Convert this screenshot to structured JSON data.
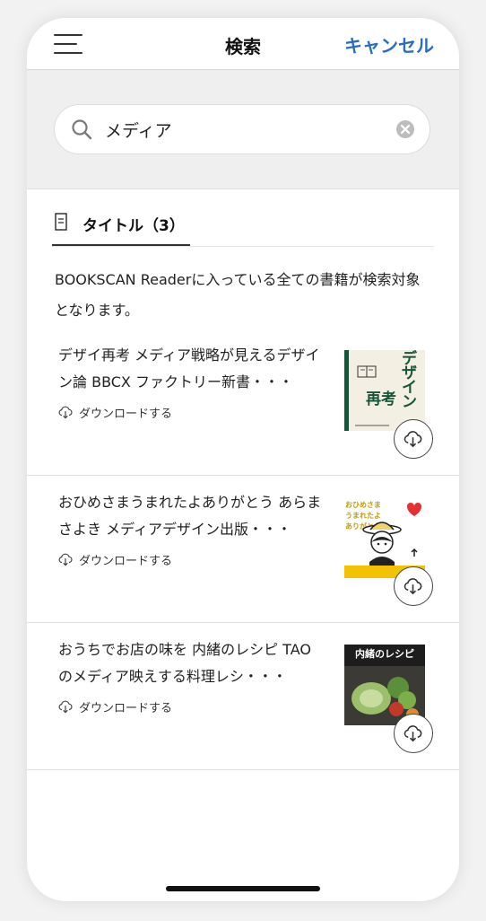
{
  "nav": {
    "title": "検索",
    "cancel_label": "キャンセル",
    "menu_icon": "hamburger-menu-icon"
  },
  "search": {
    "value": "メディア",
    "placeholder": ""
  },
  "tabs": [
    {
      "label": "タイトル（3）",
      "icon": "document-icon",
      "active": true
    }
  ],
  "description": "BOOKSCAN Readerに入っている全ての書籍が検索対象となります。",
  "books": [
    {
      "title": "デザイ再考 メディア戦略が見えるデザイン論 BBCX ファクトリー新書・・・",
      "download_label": "ダウンロードする",
      "cover": {
        "text_main": "デザイン",
        "text_sub": "再考",
        "bg": "#f3efe2",
        "accent": "#17553a"
      }
    },
    {
      "title": "おひめさまうまれたよありがとう あらまさよき メディアデザイン出版・・・",
      "download_label": "ダウンロードする",
      "cover": {
        "text_main": "おひめさま うまれたよ ありがとう",
        "bg": "#ffffff",
        "accent": "#f2c200"
      }
    },
    {
      "title": "おうちでお店の味を 内緒のレシピ TAO のメディア映えする料理レシ・・・",
      "download_label": "ダウンロードする",
      "cover": {
        "text_main": "内緒のレシピ",
        "bg": "#1d1d1d",
        "accent": "#7cae4a"
      }
    }
  ],
  "colors": {
    "accent": "#2a6cc0",
    "search_bg": "#efefef"
  }
}
